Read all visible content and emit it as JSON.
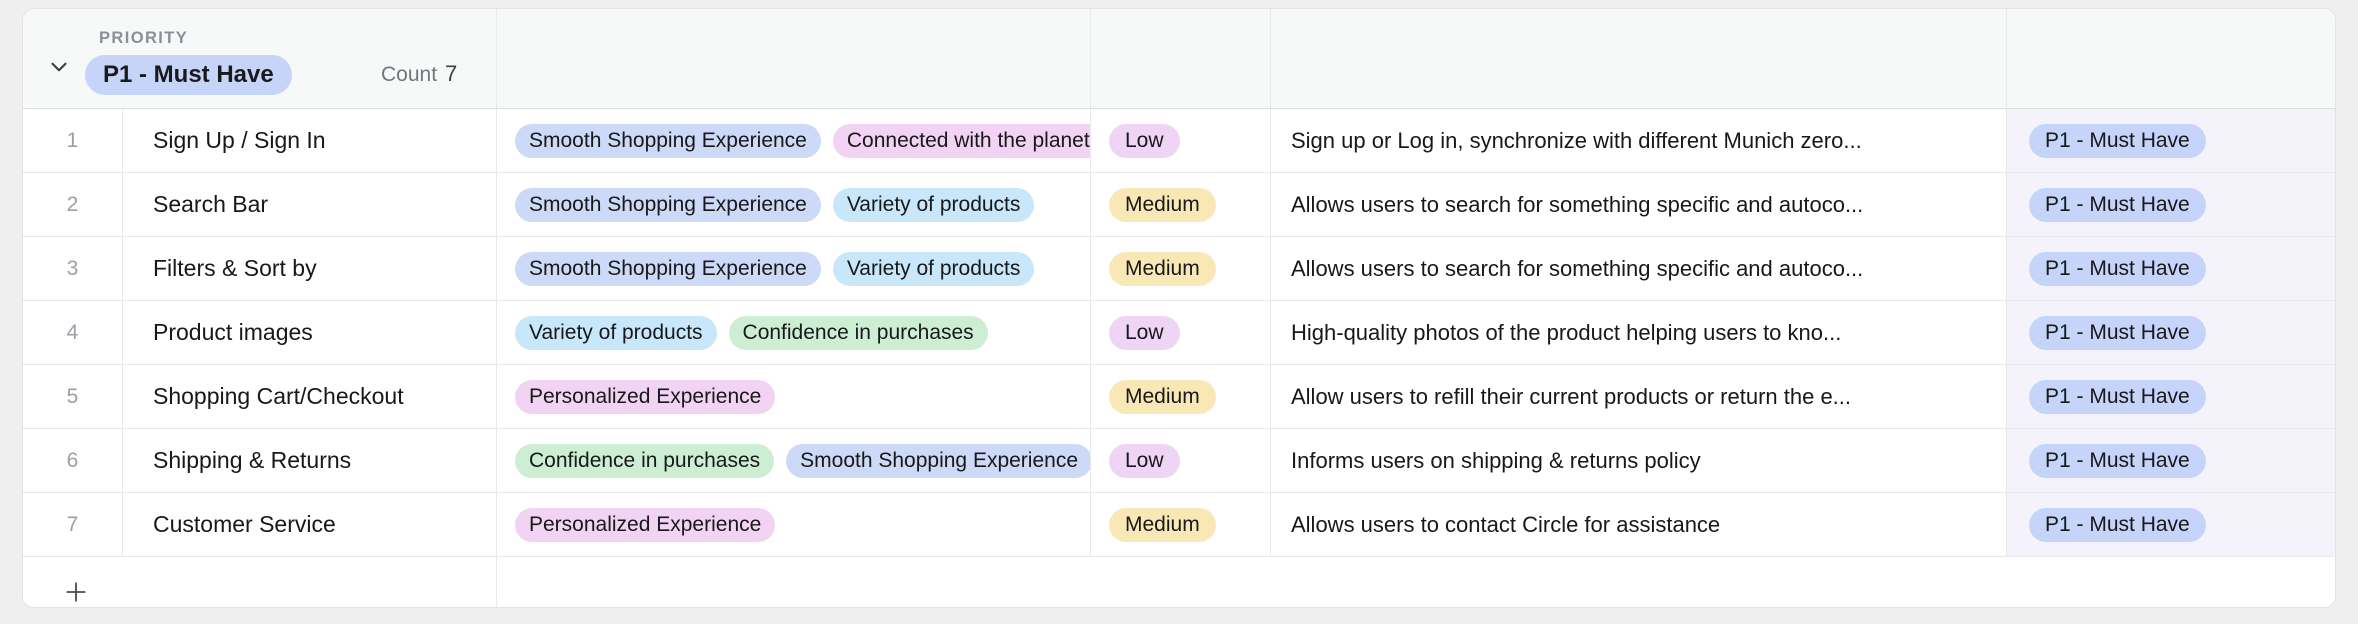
{
  "group": {
    "field_label": "PRIORITY",
    "value_chip": "P1 - Must Have",
    "count_label": "Count",
    "count_value": "7",
    "chip_color": "#c6d4f9",
    "collapse_icon": "chevron-down-icon"
  },
  "colors": {
    "tag_blue": "#ccd9f7",
    "tag_lightblue": "#c9e7fa",
    "tag_green": "#cdeed3",
    "tag_pink": "#f3d3f3",
    "tag_purple": "#eed4f7",
    "pill_low": "#f0d4f5",
    "pill_medium": "#fae7b6",
    "priority_col_bg": "#f4f3fb"
  },
  "rows": [
    {
      "index": "1",
      "name": "Sign Up / Sign In",
      "tags": [
        {
          "label": "Smooth Shopping Experience",
          "color": "#ccd9f7",
          "truncated": false
        },
        {
          "label": "Connected with the planet",
          "color": "#f3d3f3",
          "truncated": true
        }
      ],
      "effort": {
        "label": "Low",
        "color": "#f0d4f5"
      },
      "description": "Sign up or Log in, synchronize with different Munich zero...",
      "priority": "P1 - Must Have"
    },
    {
      "index": "2",
      "name": "Search Bar",
      "tags": [
        {
          "label": "Smooth Shopping Experience",
          "color": "#ccd9f7",
          "truncated": false
        },
        {
          "label": "Variety of products",
          "color": "#c9e7fa",
          "truncated": true
        }
      ],
      "effort": {
        "label": "Medium",
        "color": "#fae7b6"
      },
      "description": "Allows users to search for something specific and autoco...",
      "priority": "P1 - Must Have"
    },
    {
      "index": "3",
      "name": "Filters & Sort by",
      "tags": [
        {
          "label": "Smooth Shopping Experience",
          "color": "#ccd9f7",
          "truncated": false
        },
        {
          "label": "Variety of products",
          "color": "#c9e7fa",
          "truncated": true
        }
      ],
      "effort": {
        "label": "Medium",
        "color": "#fae7b6"
      },
      "description": "Allows users to search for something specific and autoco...",
      "priority": "P1 - Must Have"
    },
    {
      "index": "4",
      "name": "Product images",
      "tags": [
        {
          "label": "Variety of products",
          "color": "#c9e7fa",
          "truncated": false
        },
        {
          "label": "Confidence in purchases",
          "color": "#cdeed3",
          "truncated": true
        }
      ],
      "effort": {
        "label": "Low",
        "color": "#f0d4f5"
      },
      "description": "High-quality photos of the product helping users to kno...",
      "priority": "P1 - Must Have"
    },
    {
      "index": "5",
      "name": "Shopping Cart/Checkout",
      "tags": [
        {
          "label": "Personalized Experience",
          "color": "#f3d3f3",
          "truncated": false
        }
      ],
      "effort": {
        "label": "Medium",
        "color": "#fae7b6"
      },
      "description": "Allow users to refill their current products or return the e...",
      "priority": "P1 - Must Have"
    },
    {
      "index": "6",
      "name": "Shipping & Returns",
      "tags": [
        {
          "label": "Confidence in purchases",
          "color": "#cdeed3",
          "truncated": false
        },
        {
          "label": "Smooth Shopping Experience",
          "color": "#ccd9f7",
          "truncated": true
        }
      ],
      "effort": {
        "label": "Low",
        "color": "#f0d4f5"
      },
      "description": "Informs users on shipping & returns policy",
      "priority": "P1 - Must Have"
    },
    {
      "index": "7",
      "name": "Customer Service",
      "tags": [
        {
          "label": "Personalized Experience",
          "color": "#f3d3f3",
          "truncated": false
        }
      ],
      "effort": {
        "label": "Medium",
        "color": "#fae7b6"
      },
      "description": "Allows users to contact Circle for assistance",
      "priority": "P1 - Must Have"
    }
  ],
  "add_row": {
    "icon": "plus-icon"
  }
}
